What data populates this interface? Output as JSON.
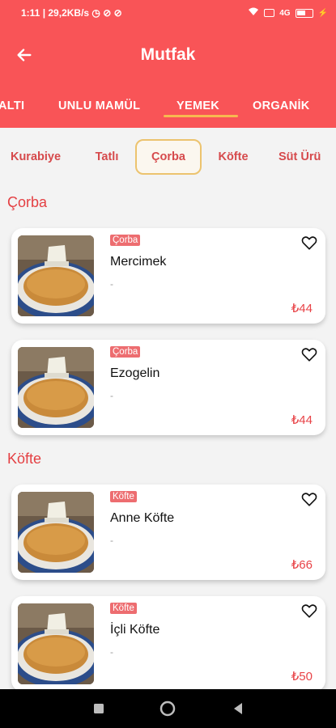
{
  "status_bar": {
    "left": "1:11 | 29,2KB/s ◷ ⊘ ⊘",
    "right": "4G"
  },
  "app_bar": {
    "title": "Mutfak"
  },
  "tabs": [
    {
      "label": "ALTI"
    },
    {
      "label": "UNLU MAMÜL"
    },
    {
      "label": "YEMEK",
      "active": true
    },
    {
      "label": "ORGANİK"
    }
  ],
  "subcategories": [
    {
      "label": "Kurabiye"
    },
    {
      "label": "Tatlı"
    },
    {
      "label": "Çorba",
      "active": true
    },
    {
      "label": "Köfte"
    },
    {
      "label": "Süt Ürü"
    }
  ],
  "sections": [
    {
      "title": "Çorba",
      "items": [
        {
          "badge": "Çorba",
          "name": "Mercimek",
          "desc": "-",
          "price": "₺44"
        },
        {
          "badge": "Çorba",
          "name": "Ezogelin",
          "desc": "-",
          "price": "₺44"
        }
      ]
    },
    {
      "title": "Köfte",
      "items": [
        {
          "badge": "Köfte",
          "name": "Anne Köfte",
          "desc": "-",
          "price": "₺66"
        },
        {
          "badge": "Köfte",
          "name": "İçli Köfte",
          "desc": "-",
          "price": "₺50"
        }
      ]
    }
  ],
  "colors": {
    "primary": "#f95457",
    "accent": "#f7b94f",
    "text_red": "#d64a4c",
    "badge": "#ed6d70"
  },
  "icons": [
    "back-arrow-icon",
    "heart-outline-icon",
    "square-icon",
    "circle-icon",
    "triangle-icon"
  ]
}
